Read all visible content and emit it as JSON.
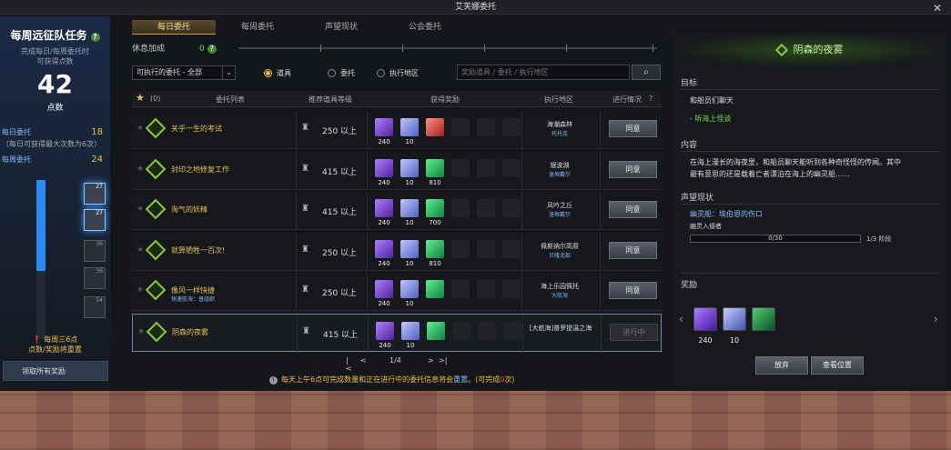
{
  "window_title": "艾芙娜委托",
  "left_panel": {
    "title": "每周远征队任务",
    "subtitle_line1": "完成每日/每周委托时",
    "subtitle_line2": "可获得点数",
    "points": "42",
    "points_label": "点数",
    "daily_label": "每日委托",
    "daily_value": "18",
    "daily_note": "（每日可获得最大次数为6次）",
    "weekly_label": "每周委托",
    "weekly_value": "24",
    "tier_labels": [
      "27",
      "27",
      "36",
      "36",
      "54"
    ],
    "note_line1": "每周三6点",
    "note_line2": "点数/奖励将重置",
    "claim_label": "领取所有奖励"
  },
  "tabs": [
    "每日委托",
    "每周委托",
    "声望现状",
    "公会委托"
  ],
  "rest_bonus": {
    "label": "休息加成",
    "value": "0",
    "help": "?"
  },
  "filter": {
    "select_value": "可执行的委托 - 全部",
    "radios": [
      "道具",
      "委托",
      "执行地区"
    ],
    "radio_selected": "道具",
    "search_placeholder": "奖励道具 / 委托 / 执行地区"
  },
  "table_header": {
    "fav_count": "(0)",
    "col_list": "委托列表",
    "col_level": "推荐道具等级",
    "col_reward": "获得奖励",
    "col_area": "执行地区",
    "col_status": "进行情况",
    "help": "?"
  },
  "rows": [
    {
      "name": "关乎一生的考试",
      "sub": "",
      "level": "250 以上",
      "rewards": [
        {
          "c": "p",
          "n": "240"
        },
        {
          "c": "b",
          "n": "10"
        },
        {
          "c": "r",
          "n": ""
        }
      ],
      "area": "海潮森林",
      "area_sub": "托托克",
      "action": "同意"
    },
    {
      "name": "封印之地修复工作",
      "sub": "",
      "level": "415 以上",
      "rewards": [
        {
          "c": "p",
          "n": "240"
        },
        {
          "c": "b",
          "n": "10"
        },
        {
          "c": "g",
          "n": "810"
        }
      ],
      "area": "银波湖",
      "area_sub": "洛恒戴尔",
      "action": "同意"
    },
    {
      "name": "淘气的妖精",
      "sub": "",
      "level": "415 以上",
      "rewards": [
        {
          "c": "p",
          "n": "240"
        },
        {
          "c": "b",
          "n": "10"
        },
        {
          "c": "g",
          "n": "700"
        }
      ],
      "area": "风吟之丘",
      "area_sub": "洛恒戴尔",
      "action": "同意"
    },
    {
      "name": "就算牺牲一百次!",
      "sub": "",
      "level": "250 以上",
      "rewards": [
        {
          "c": "p",
          "n": "240"
        },
        {
          "c": "b",
          "n": "10"
        },
        {
          "c": "g",
          "n": "810"
        }
      ],
      "area": "佩斯纳尔高原",
      "area_sub": "贝隆北部",
      "action": "同意"
    },
    {
      "name": "像风一样快捷",
      "sub": "快速航海：普组织",
      "level": "250 以上",
      "rewards": [
        {
          "c": "p",
          "n": "240"
        },
        {
          "c": "b",
          "n": "10"
        },
        {
          "c": "g",
          "n": ""
        }
      ],
      "area": "海上乐园佩托",
      "area_sub": "大航海",
      "action": "同意"
    },
    {
      "name": "阴森的夜雾",
      "sub": "",
      "level": "415 以上",
      "rewards": [
        {
          "c": "p",
          "n": "240"
        },
        {
          "c": "b",
          "n": "10"
        },
        {
          "c": "g",
          "n": ""
        }
      ],
      "area": "[大航海]普罗提温之海",
      "area_sub": "",
      "action": "进行中"
    }
  ],
  "pager": {
    "first": "|<",
    "prev": "<",
    "page": "1/4",
    "next": ">",
    "last": ">|"
  },
  "notice": {
    "pre": "每天上午6点可完成数量和正在进行中的委托信息将会",
    "highlight": "重置",
    "post": "。(可完成",
    "count": "0",
    "tail": "次)"
  },
  "detail": {
    "title": "阴森的夜雾",
    "goal_label": "目标",
    "goal_text": "和船员们聊天",
    "goal_sub": "- 听海上怪谈",
    "content_label": "内容",
    "content_line1": "在海上漫长的海夜里，和船员聊天能听到各种奇怪怪的传闻。其中",
    "content_line2": "最有意思的还是载着亡者漂泊在海上的幽灵船……",
    "rep_label": "声望现状",
    "rep_name": "幽灵船：埃伯恩的伤口",
    "rep_rank": "幽灵入侵者",
    "rep_progress": "0/30",
    "rep_progress_fraction": 0.0,
    "rep_stage": "1/3 阶段",
    "reward_label": "奖励",
    "rewards": [
      {
        "c": "p",
        "n": "240"
      },
      {
        "c": "b",
        "n": "10"
      },
      {
        "c": "g",
        "n": ""
      }
    ],
    "abandon_label": "放弃",
    "locate_label": "查看位置"
  }
}
